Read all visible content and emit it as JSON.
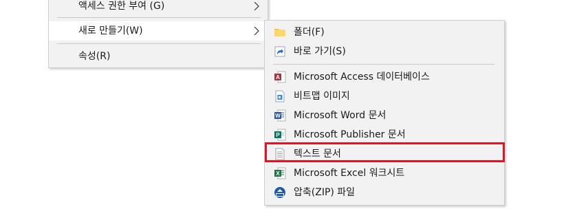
{
  "parent_menu": {
    "items": [
      {
        "label": "액세스 권한 부여 (G)",
        "has_submenu": true
      },
      {
        "label": "새로 만들기(W)",
        "has_submenu": true,
        "highlighted": true
      },
      {
        "label": "속성(R)",
        "has_submenu": false
      }
    ]
  },
  "submenu": {
    "items": [
      {
        "label": "폴더(F)",
        "icon": "folder-icon"
      },
      {
        "label": "바로 가기(S)",
        "icon": "shortcut-icon"
      },
      {
        "label": "Microsoft Access 데이터베이스",
        "icon": "access-icon"
      },
      {
        "label": "비트맵 이미지",
        "icon": "bitmap-icon"
      },
      {
        "label": "Microsoft Word 문서",
        "icon": "word-icon"
      },
      {
        "label": "Microsoft Publisher 문서",
        "icon": "publisher-icon"
      },
      {
        "label": "텍스트 문서",
        "icon": "text-document-icon",
        "highlighted": true
      },
      {
        "label": "Microsoft Excel 워크시트",
        "icon": "excel-icon"
      },
      {
        "label": "압축(ZIP) 파일",
        "icon": "zip-icon"
      }
    ]
  },
  "colors": {
    "menu_bg": "#f2f2f2",
    "highlight_bg": "#ffffff",
    "highlight_border": "#e81123"
  }
}
